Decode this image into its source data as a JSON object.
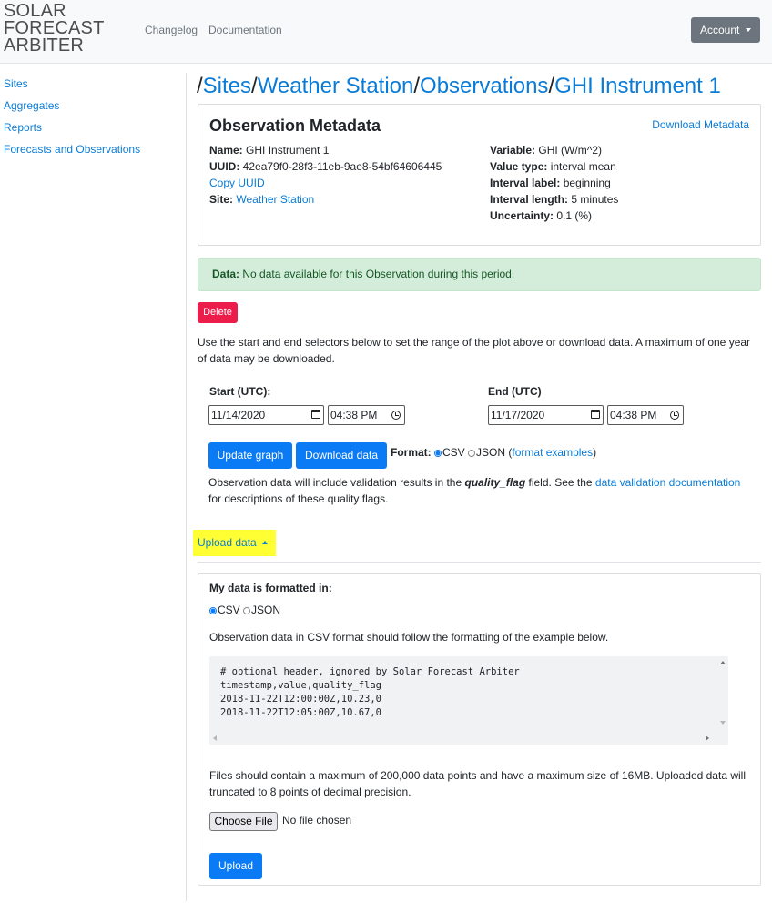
{
  "header": {
    "brand_lines": [
      "SOLAR",
      "FORECAST",
      "ARBITER"
    ],
    "nav": [
      "Changelog",
      "Documentation"
    ],
    "account_label": "Account"
  },
  "sidebar": {
    "items": [
      {
        "label": "Sites"
      },
      {
        "label": "Aggregates"
      },
      {
        "label": "Reports"
      },
      {
        "label": "Forecasts and Observations"
      }
    ]
  },
  "breadcrumb": {
    "separator": "/",
    "items": [
      "Sites",
      "Weather Station",
      "Observations",
      "GHI Instrument 1"
    ]
  },
  "metadata": {
    "title": "Observation Metadata",
    "download_label": "Download Metadata",
    "name_label": "Name:",
    "name": "GHI Instrument 1",
    "uuid_label": "UUID:",
    "uuid": "42ea79f0-28f3-11eb-9ae8-54bf64606445",
    "copy_uuid": "Copy UUID",
    "site_label": "Site:",
    "site": "Weather Station",
    "variable_label": "Variable:",
    "variable": "GHI (W/m^2)",
    "value_type_label": "Value type:",
    "value_type": "interval mean",
    "interval_label_label": "Interval label:",
    "interval_label": "beginning",
    "interval_length_label": "Interval length:",
    "interval_length": "5 minutes",
    "uncertainty_label": "Uncertainty:",
    "uncertainty": "0.1 (%)"
  },
  "alert": {
    "strong": "Data:",
    "text": " No data available for this Observation during this period."
  },
  "delete_label": "Delete",
  "range_text": "Use the start and end selectors below to set the range of the plot above or download data. A maximum of one year of data may be downloaded.",
  "start": {
    "label": "Start (UTC):",
    "date": "11/14/2020",
    "time": "04:38 PM"
  },
  "end": {
    "label": "End (UTC)",
    "date": "11/17/2020",
    "time": "04:38 PM"
  },
  "buttons": {
    "update_graph": "Update graph",
    "download_data": "Download data"
  },
  "format": {
    "label": "Format:",
    "options": [
      "CSV",
      "JSON"
    ],
    "selected": "CSV",
    "examples_link": "format examples"
  },
  "validation": {
    "text1": "Observation data will include validation results in the ",
    "field": "quality_flag",
    "text2": " field. See the ",
    "link": "data validation documentation",
    "text3": "for descriptions of these quality flags."
  },
  "upload": {
    "toggle_label": "Upload data",
    "formatted_label": "My data is formatted in:",
    "options": [
      "CSV",
      "JSON"
    ],
    "selected": "CSV",
    "csv_hint": "Observation data in CSV format should follow the formatting of the example below.",
    "code_lines": [
      "# optional header, ignored by Solar Forecast Arbiter",
      "timestamp,value,quality_flag",
      "2018-11-22T12:00:00Z,10.23,0",
      "2018-11-22T12:05:00Z,10.67,0"
    ],
    "limits_text": "Files should contain a maximum of 200,000 data points and have a maximum size of 16MB. Uploaded data will truncated to 8 points of decimal precision.",
    "choose_file": "Choose File",
    "no_file": "No file chosen",
    "upload_button": "Upload"
  },
  "colors": {
    "link": "#0a7bd6",
    "primary_button": "#0a7bf5",
    "delete_button": "#ec1c4b",
    "alert_bg": "#d4edda",
    "highlight": "#ffff33",
    "account_button": "#6c757d"
  }
}
